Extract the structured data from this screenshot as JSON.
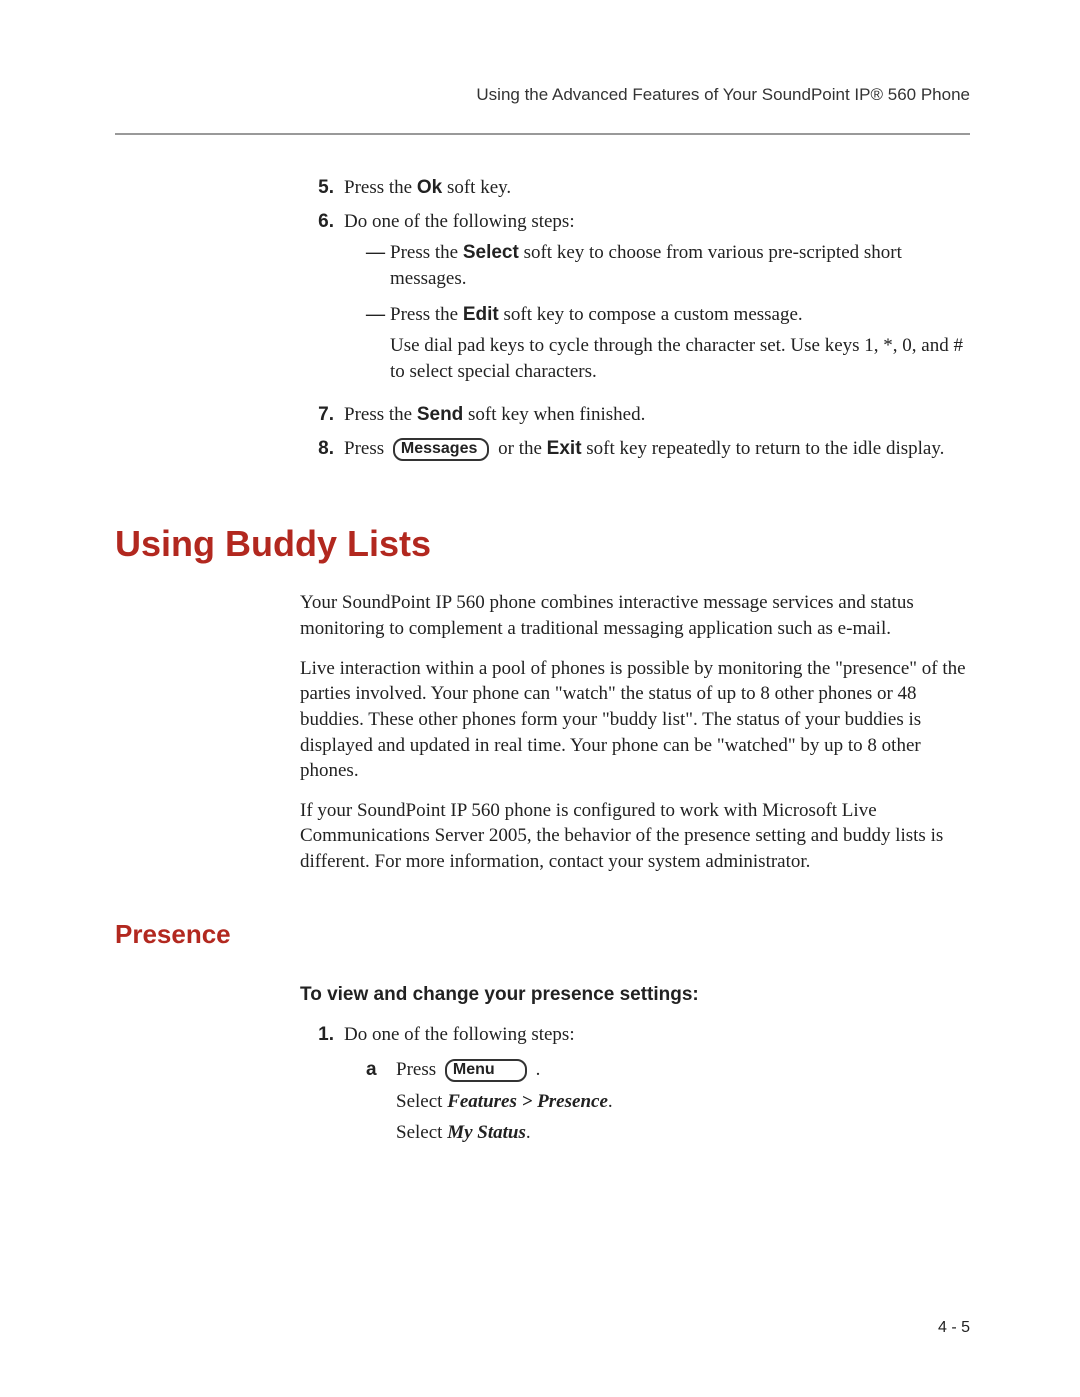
{
  "running_head": "Using the Advanced Features of Your SoundPoint IP® 560 Phone",
  "steps": {
    "s5": {
      "marker": "5.",
      "pre": "Press the ",
      "key": "Ok",
      "post": " soft key."
    },
    "s6": {
      "marker": "6.",
      "text": "Do one of the following steps:",
      "d1": {
        "pre": "Press the ",
        "key": "Select",
        "post": " soft key to choose from various pre-scripted short messages."
      },
      "d2": {
        "pre": "Press the ",
        "key": "Edit",
        "post": " soft key to compose a custom message.",
        "extra": "Use dial pad keys to cycle through the character set. Use keys 1, *, 0, and # to select special characters."
      }
    },
    "s7": {
      "marker": "7.",
      "pre": "Press the ",
      "key": "Send",
      "post": " soft key when finished."
    },
    "s8": {
      "marker": "8.",
      "pre": "Press ",
      "btn": "Messages",
      "mid": " or the ",
      "key": "Exit",
      "post": " soft key repeatedly to return to the idle display."
    }
  },
  "h1": "Using Buddy Lists",
  "paras": {
    "p1": "Your SoundPoint IP 560 phone combines interactive message services and status monitoring to complement a traditional messaging application such as e-mail.",
    "p2": "Live interaction within a pool of phones is possible by monitoring the \"presence\" of the parties involved. Your phone can \"watch\" the status of up to 8 other phones or 48 buddies. These other phones form your \"buddy list\". The status of your buddies is displayed and updated in real time. Your phone can be \"watched\" by up to 8 other phones.",
    "p3": "If your SoundPoint IP 560 phone is configured to work with Microsoft Live Communications Server 2005, the behavior of the presence setting and buddy lists is different. For more information, contact your system administrator."
  },
  "h2": "Presence",
  "task_head": "To view and change your presence settings:",
  "task": {
    "t1": {
      "marker": "1.",
      "text": "Do one of the following steps:",
      "a": {
        "marker": "a",
        "l1_pre": "Press ",
        "l1_btn": "Menu",
        "l1_post": " .",
        "l2_pre": "Select ",
        "l2_bold": "Features > Presence",
        "l2_post": ".",
        "l3_pre": "Select ",
        "l3_bold": "My Status",
        "l3_post": "."
      }
    }
  },
  "pagenum": "4 - 5"
}
